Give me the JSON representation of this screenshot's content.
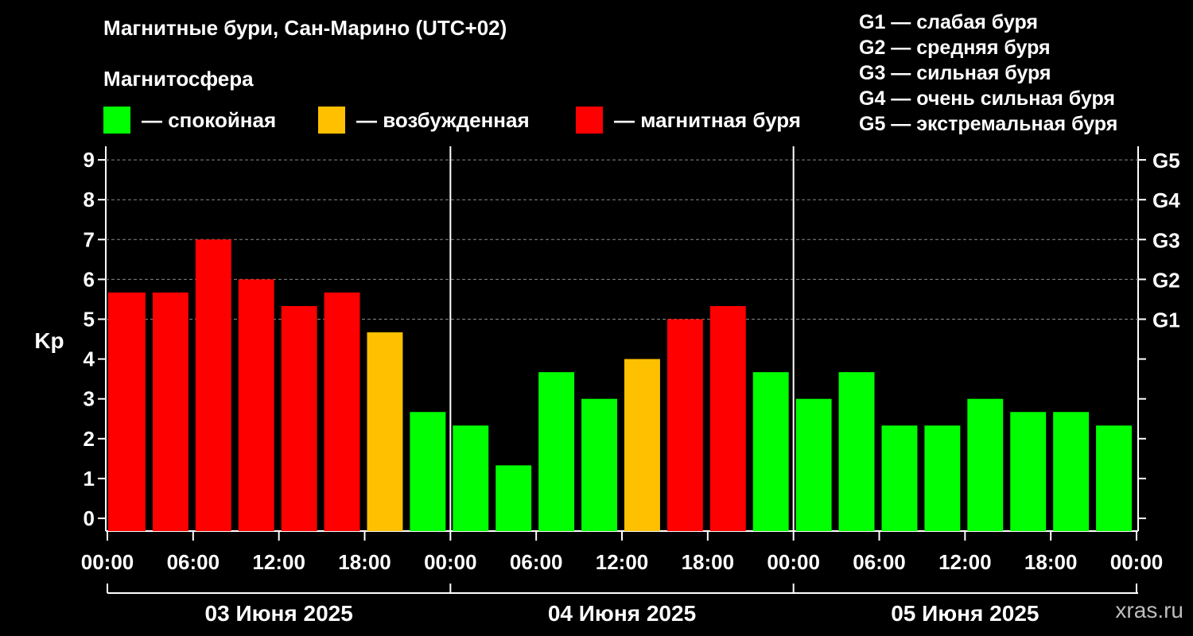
{
  "title": "Магнитные бури, Сан-Марино (UTC+02)",
  "subtitle": "Магнитосфера",
  "legend": [
    {
      "label": "— спокойная",
      "color": "#00ff00"
    },
    {
      "label": "— возбужденная",
      "color": "#ffc000"
    },
    {
      "label": "— магнитная буря",
      "color": "#ff0000"
    }
  ],
  "g_scale": [
    "G1 — слабая буря",
    "G2 — средняя буря",
    "G3 — сильная буря",
    "G4 — очень сильная буря",
    "G5 — экстремальная буря"
  ],
  "watermark": "xras.ru",
  "chart_data": {
    "type": "bar",
    "ylabel": "Kp",
    "ylim": [
      0,
      9
    ],
    "y_ticks": [
      "0",
      "1",
      "2",
      "3",
      "4",
      "5",
      "6",
      "7",
      "8",
      "9"
    ],
    "right_labels": [
      {
        "kp": 5,
        "label": "G1"
      },
      {
        "kp": 6,
        "label": "G2"
      },
      {
        "kp": 7,
        "label": "G3"
      },
      {
        "kp": 8,
        "label": "G4"
      },
      {
        "kp": 9,
        "label": "G5"
      }
    ],
    "x_ticks": [
      "00:00",
      "06:00",
      "12:00",
      "18:00",
      "00:00",
      "06:00",
      "12:00",
      "18:00",
      "00:00",
      "06:00",
      "12:00",
      "18:00",
      "00:00"
    ],
    "days": [
      "03 Июня 2025",
      "04 Июня 2025",
      "05 Июня 2025"
    ],
    "grid": true,
    "series": [
      {
        "values": [
          5.67,
          5.67,
          7.0,
          6.0,
          5.33,
          5.67,
          4.67,
          2.67,
          2.33,
          1.33,
          3.67,
          3.0,
          4.0,
          5.0,
          5.33,
          3.67,
          3.0,
          3.67,
          2.33,
          2.33,
          3.0,
          2.67,
          2.67,
          2.33,
          2.33
        ],
        "colors": [
          "#ff0000",
          "#ff0000",
          "#ff0000",
          "#ff0000",
          "#ff0000",
          "#ff0000",
          "#ffc000",
          "#00ff00",
          "#00ff00",
          "#00ff00",
          "#00ff00",
          "#00ff00",
          "#ffc000",
          "#ff0000",
          "#ff0000",
          "#00ff00",
          "#00ff00",
          "#00ff00",
          "#00ff00",
          "#00ff00",
          "#00ff00",
          "#00ff00",
          "#00ff00",
          "#00ff00",
          "#00ff00"
        ]
      }
    ]
  }
}
